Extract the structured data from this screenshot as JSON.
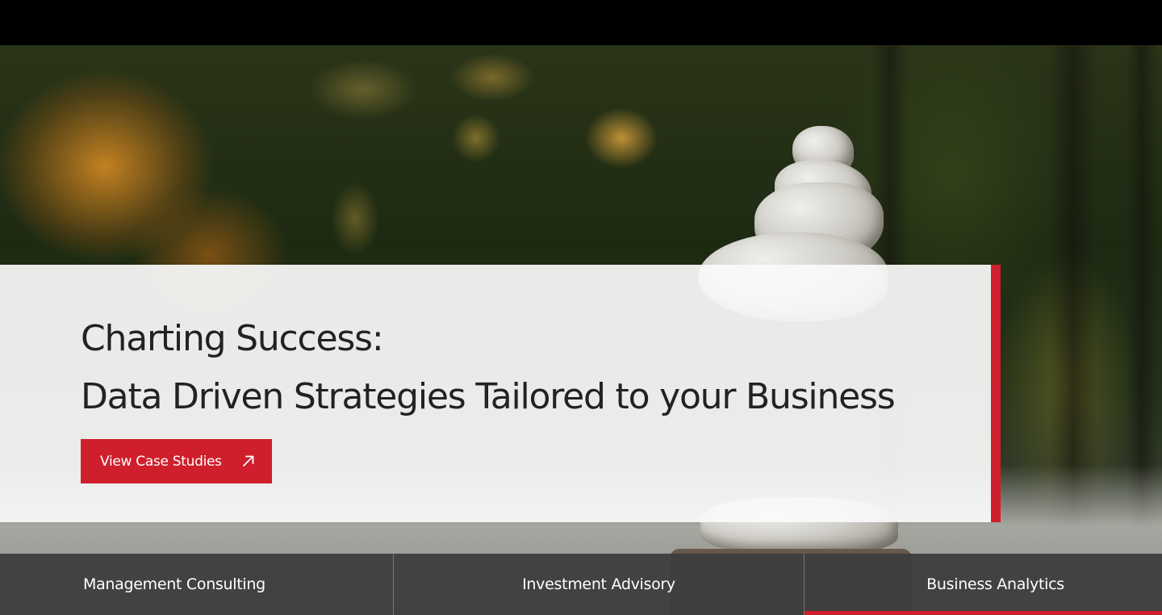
{
  "hero": {
    "headline_line1": "Charting Success:",
    "headline_line2": "Data Driven Strategies Tailored to your Business",
    "cta_label": "View Case Studies",
    "cta_icon": "arrow-up-right-icon"
  },
  "tabs": [
    {
      "label": "Management Consulting",
      "active": false
    },
    {
      "label": "Investment Advisory",
      "active": false
    },
    {
      "label": "Business Analytics",
      "active": true
    }
  ],
  "colors": {
    "accent": "#cf1f2c",
    "panel": "#fafafa",
    "text_dark": "#222222",
    "tab_bg": "#3e3e3e"
  }
}
